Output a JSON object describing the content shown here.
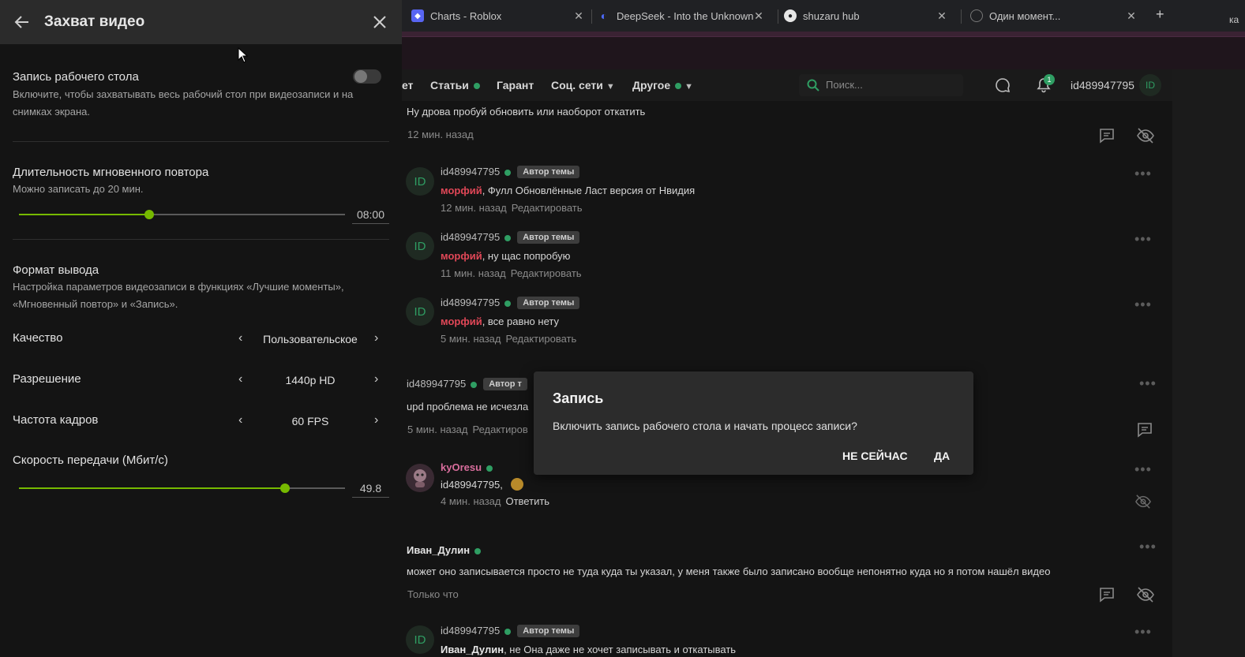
{
  "panel": {
    "title": "Захват видео",
    "desktop_rec": {
      "label": "Запись рабочего стола",
      "desc": "Включите, чтобы захватывать весь рабочий стол при видеозаписи и на снимках экрана.",
      "enabled": false
    },
    "replay": {
      "label": "Длительность мгновенного повтора",
      "desc": "Можно записать до 20 мин.",
      "value": "08:00",
      "fraction": 0.4
    },
    "output": {
      "label": "Формат вывода",
      "desc": "Настройка параметров видеозаписи в функциях «Лучшие моменты», «Мгновенный повтор» и «Запись»."
    },
    "quality": {
      "label": "Качество",
      "value": "Пользовательское"
    },
    "resolution": {
      "label": "Разрешение",
      "value": "1440p HD"
    },
    "fps": {
      "label": "Частота кадров",
      "value": "60 FPS"
    },
    "bitrate": {
      "label": "Скорость передачи (Мбит/с)",
      "value": "49.8",
      "fraction": 0.816
    },
    "accent": "#76b900"
  },
  "browser": {
    "tabs": [
      {
        "title": "Charts - Roblox",
        "icon": "roblox-icon"
      },
      {
        "title": "DeepSeek - Into the Unknown",
        "icon": "deepseek-icon"
      },
      {
        "title": "shuzaru hub",
        "icon": "github-icon"
      },
      {
        "title": "Один момент...",
        "icon": "globe-icon"
      }
    ],
    "clipped": "ка"
  },
  "site": {
    "nav": {
      "partial": "ет",
      "articles": "Статьи",
      "guarantor": "Гарант",
      "social": "Соц. сети",
      "other": "Другое",
      "search_placeholder": "Поиск...",
      "notif_count": "1",
      "username": "id489947795",
      "avatar": "ID"
    },
    "accent": "#2f9e63",
    "author_badge": "Автор темы",
    "author_badge_cut": "Автор т",
    "posts": [
      {
        "text": "Ну дрова пробуй обновить или наоборот откатить",
        "time": "12 мин. назад"
      },
      {
        "user": "id489947795",
        "avatar": "ID",
        "mention": "морфий",
        "text": ", Фулл Обновлённые Ласт версия от Нвидия",
        "time": "12 мин. назад",
        "action": "Редактировать"
      },
      {
        "user": "id489947795",
        "avatar": "ID",
        "mention": "морфий",
        "text": ", ну щас попробую",
        "time": "11 мин. назад",
        "action": "Редактировать"
      },
      {
        "user": "id489947795",
        "avatar": "ID",
        "mention": "морфий",
        "text": ", все равно нету",
        "time": "5 мин. назад",
        "action": "Редактировать"
      },
      {
        "user": "id489947795",
        "text": "upd проблема не исчезла",
        "time": "5 мин. назад",
        "action": "Редактиров"
      },
      {
        "user": "kyOresu",
        "text": "id489947795,",
        "time": "4 мин. назад",
        "action": "Ответить"
      },
      {
        "user": "Иван_Дулин",
        "text": "может оно записывается просто не туда куда ты указал, у меня также было записано вообще непонятно куда но я потом нашёл видео",
        "time": "Только что"
      },
      {
        "user": "id489947795",
        "avatar": "ID",
        "mention": "Иван_Дулин",
        "text": ", не Она даже не хочет записывать и откатывать"
      }
    ]
  },
  "dialog": {
    "title": "Запись",
    "text": "Включить запись рабочего стола и начать процесс записи?",
    "cancel": "НЕ СЕЙЧАС",
    "confirm": "ДА"
  }
}
